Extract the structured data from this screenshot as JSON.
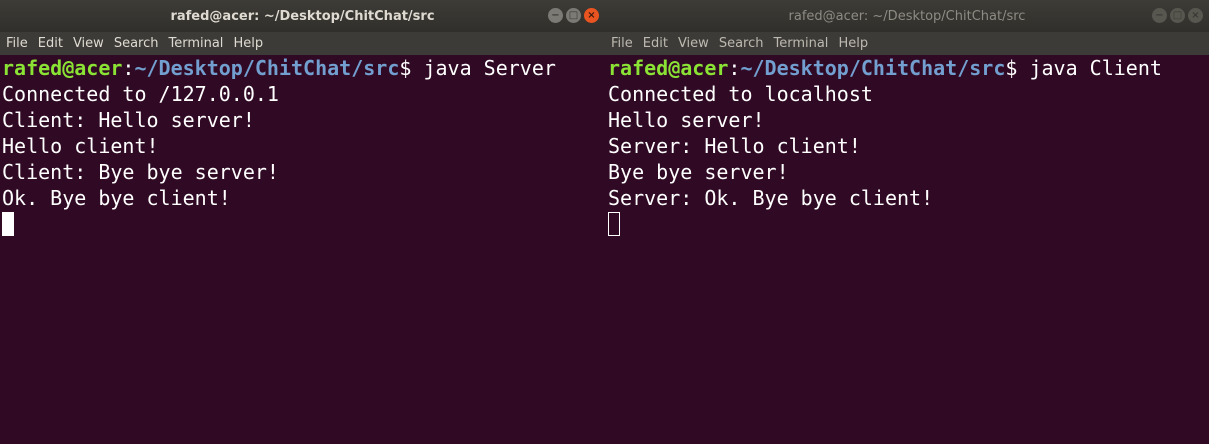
{
  "left_window": {
    "title": "rafed@acer: ~/Desktop/ChitChat/src",
    "menu": [
      "File",
      "Edit",
      "View",
      "Search",
      "Terminal",
      "Help"
    ],
    "prompt": {
      "user": "rafed@acer",
      "colon": ":",
      "path": "~/Desktop/ChitChat/src",
      "dollar": "$",
      "command": " java Server"
    },
    "output": [
      "Connected to /127.0.0.1",
      "Client: Hello server!",
      "Hello client!",
      "Client: Bye bye server!",
      "Ok. Bye bye client!"
    ]
  },
  "right_window": {
    "title": "rafed@acer: ~/Desktop/ChitChat/src",
    "menu": [
      "File",
      "Edit",
      "View",
      "Search",
      "Terminal",
      "Help"
    ],
    "prompt": {
      "user": "rafed@acer",
      "colon": ":",
      "path": "~/Desktop/ChitChat/src",
      "dollar": "$",
      "command": " java Client"
    },
    "output": [
      "Connected to localhost",
      "Hello server!",
      "Server: Hello client!",
      "Bye bye server!",
      "Server: Ok. Bye bye client!"
    ]
  },
  "window_buttons": {
    "minimize_icon": "minimize-icon",
    "maximize_icon": "maximize-icon",
    "close_icon": "close-icon"
  },
  "colors": {
    "terminal_bg": "#300a24",
    "prompt_user": "#8ae234",
    "prompt_path": "#729fcf",
    "close_button": "#e95420"
  }
}
